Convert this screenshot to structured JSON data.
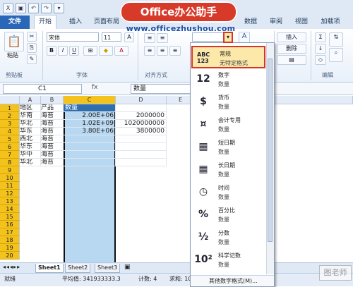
{
  "banner": {
    "title": "Office办公助手",
    "url": "www.officezhushou.com"
  },
  "tabs": [
    "文件",
    "开始",
    "插入",
    "页面布局",
    "公式",
    "数据",
    "审阅",
    "视图",
    "加载项"
  ],
  "ribbon": {
    "paste_label": "粘贴",
    "font_name": "宋体",
    "font_size": "11",
    "insert_label": "插入",
    "delete_label": "删除",
    "groups": [
      "剪贴板",
      "字体",
      "对齐方式",
      "编辑"
    ]
  },
  "formula_bar": {
    "name_box": "C1",
    "fx": "fx",
    "content": "数量"
  },
  "grid": {
    "columns": [
      "A",
      "B",
      "C",
      "D",
      "E"
    ],
    "row_numbers": [
      "1",
      "2",
      "3",
      "4",
      "5",
      "6",
      "7",
      "8",
      "9",
      "10",
      "11",
      "12",
      "13",
      "14",
      "15",
      "16",
      "17",
      "18",
      "19",
      "20"
    ],
    "rows": [
      {
        "a": "地区",
        "b": "产品",
        "c": "数量",
        "d": ""
      },
      {
        "a": "华南",
        "b": "海苔",
        "c": "2.00E+06",
        "d": "2000000"
      },
      {
        "a": "华北",
        "b": "海苔",
        "c": "1.02E+09",
        "d": "1020000000"
      },
      {
        "a": "华东",
        "b": "海苔",
        "c": "3.80E+06",
        "d": "3800000"
      },
      {
        "a": "西北",
        "b": "海苔",
        "c": "",
        "d": ""
      },
      {
        "a": "华东",
        "b": "海苔",
        "c": "",
        "d": ""
      },
      {
        "a": "华中",
        "b": "海苔",
        "c": "",
        "d": ""
      },
      {
        "a": "华北",
        "b": "海苔",
        "c": "",
        "d": ""
      }
    ]
  },
  "sheets": [
    "Sheet1",
    "Sheet2",
    "Sheet3"
  ],
  "status": {
    "ready": "就绪",
    "average": "平均值: 341933333.3",
    "count": "计数: 4",
    "sum": "求和: 10258"
  },
  "format_menu": {
    "items": [
      {
        "icon": "ABC 123",
        "name": "常规",
        "sub": "无特定格式"
      },
      {
        "icon": "12",
        "name": "数字",
        "sub": "数量"
      },
      {
        "icon": "$",
        "name": "货币",
        "sub": "数量"
      },
      {
        "icon": "¤",
        "name": "会计专用",
        "sub": "数量"
      },
      {
        "icon": "▦",
        "name": "短日期",
        "sub": "数量"
      },
      {
        "icon": "▦",
        "name": "长日期",
        "sub": "数量"
      },
      {
        "icon": "◷",
        "name": "时间",
        "sub": "数量"
      },
      {
        "icon": "%",
        "name": "百分比",
        "sub": "数量"
      },
      {
        "icon": "½",
        "name": "分数",
        "sub": "数量"
      },
      {
        "icon": "10²",
        "name": "科学记数",
        "sub": "数量"
      }
    ],
    "more": "其他数字格式(M)..."
  },
  "watermark": "图老师"
}
